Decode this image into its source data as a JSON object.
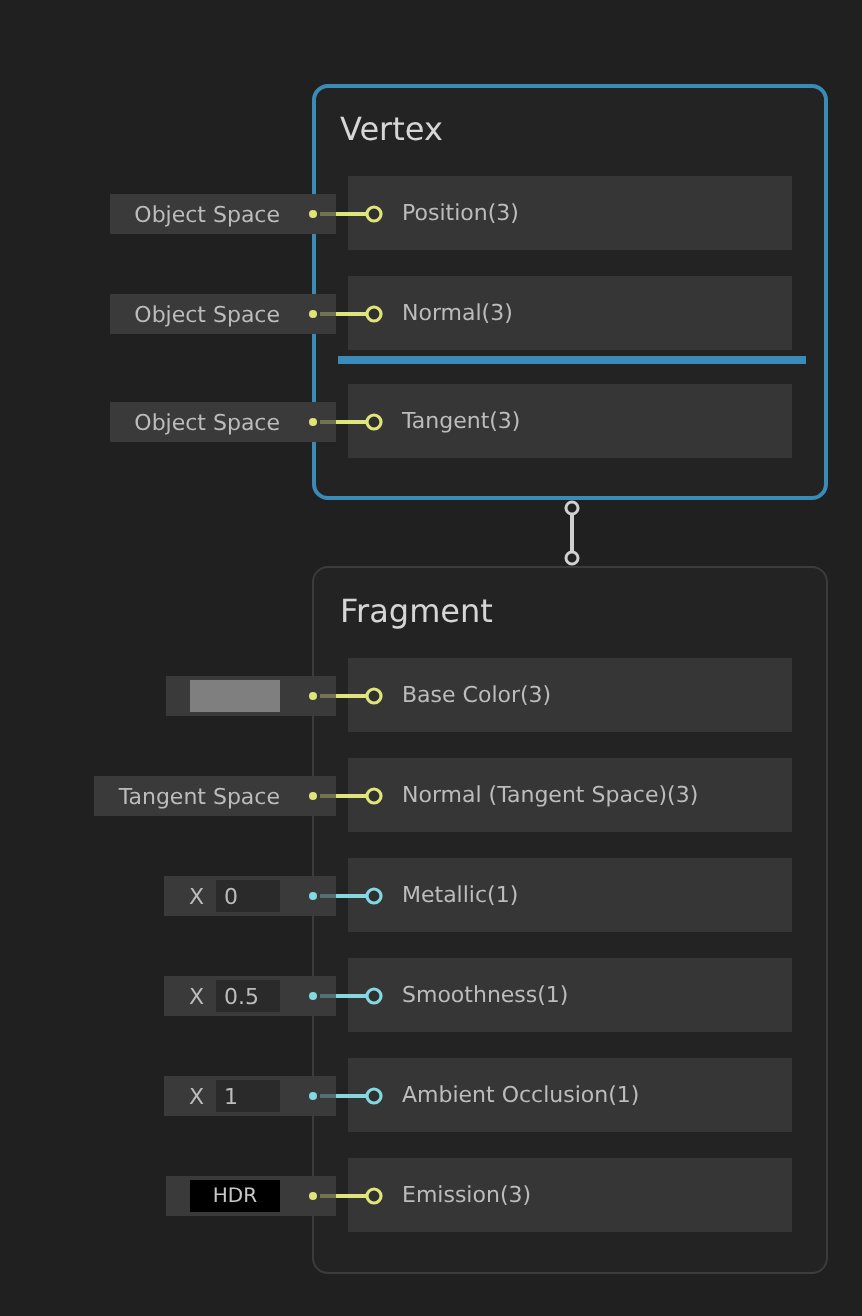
{
  "blocks": [
    {
      "title": "Vertex",
      "selected": true,
      "ports": [
        {
          "label": "Position(3)",
          "color": "#dfe57a",
          "drop_marker_below": false,
          "input": {
            "kind": "dropdown",
            "text": "Object Space"
          }
        },
        {
          "label": "Normal(3)",
          "color": "#dfe57a",
          "drop_marker_below": true,
          "input": {
            "kind": "dropdown",
            "text": "Object Space"
          }
        },
        {
          "label": "Tangent(3)",
          "color": "#dfe57a",
          "drop_marker_below": false,
          "input": {
            "kind": "dropdown",
            "text": "Object Space"
          }
        }
      ]
    },
    {
      "title": "Fragment",
      "selected": false,
      "ports": [
        {
          "label": "Base Color(3)",
          "color": "#dfe57a",
          "drop_marker_below": false,
          "input": {
            "kind": "color",
            "color": "#7f7f7f"
          }
        },
        {
          "label": "Normal (Tangent Space)(3)",
          "color": "#dfe57a",
          "drop_marker_below": false,
          "input": {
            "kind": "dropdown",
            "text": "Tangent Space"
          }
        },
        {
          "label": "Metallic(1)",
          "color": "#84d8e0",
          "drop_marker_below": false,
          "input": {
            "kind": "float",
            "axis": "X",
            "value": "0"
          }
        },
        {
          "label": "Smoothness(1)",
          "color": "#84d8e0",
          "drop_marker_below": false,
          "input": {
            "kind": "float",
            "axis": "X",
            "value": "0.5"
          }
        },
        {
          "label": "Ambient Occlusion(1)",
          "color": "#84d8e0",
          "drop_marker_below": false,
          "input": {
            "kind": "float",
            "axis": "X",
            "value": "1"
          }
        },
        {
          "label": "Emission(3)",
          "color": "#dfe57a",
          "drop_marker_below": false,
          "input": {
            "kind": "hdr",
            "color": "#000000",
            "text": "HDR"
          }
        }
      ]
    }
  ]
}
